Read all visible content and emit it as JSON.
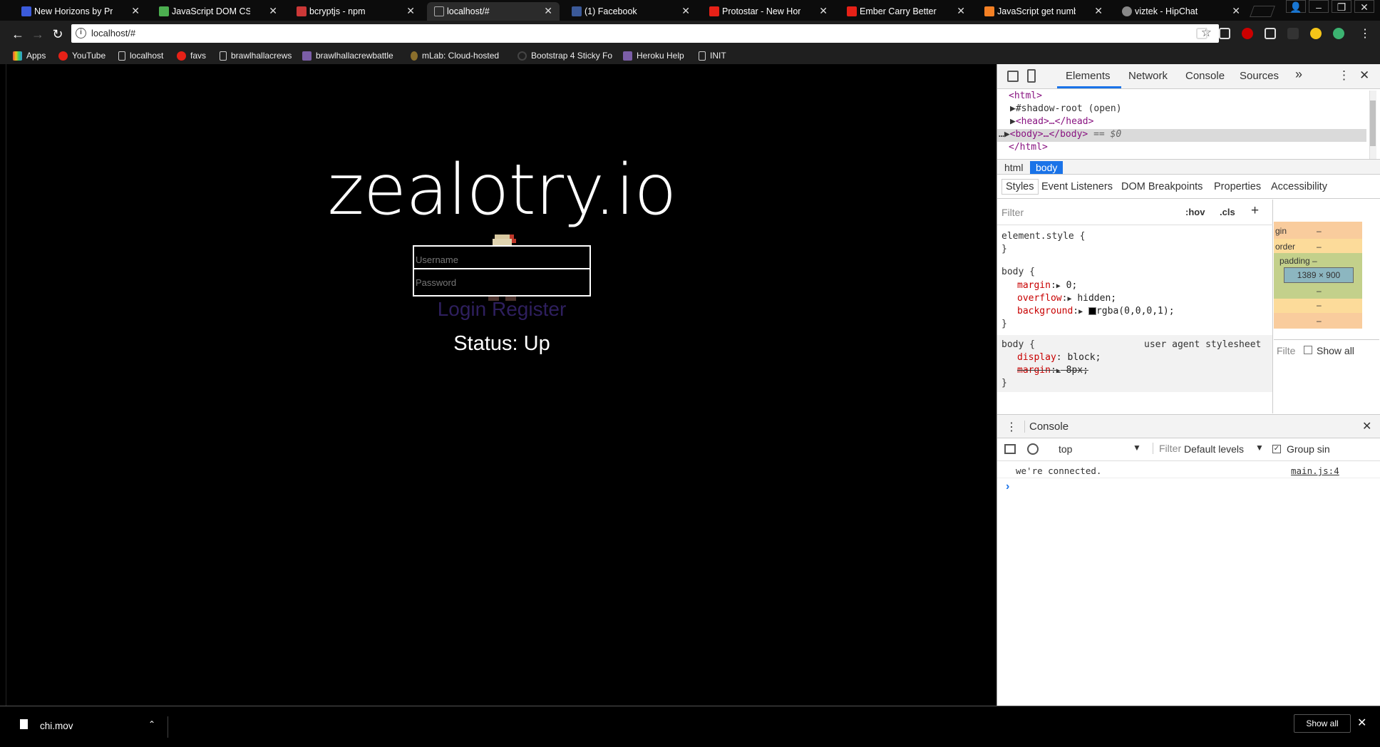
{
  "tabs": [
    {
      "title": "New Horizons by Protos",
      "color": "#3b5bdb"
    },
    {
      "title": "JavaScript DOM CSS",
      "color": "#4caf50"
    },
    {
      "title": "bcryptjs - npm",
      "color": "#cb3837"
    },
    {
      "title": "localhost/#",
      "color": "#888888"
    },
    {
      "title": "(1) Facebook",
      "color": "#3b5998"
    },
    {
      "title": "Protostar - New Horizon",
      "color": "#e62117"
    },
    {
      "title": "Ember Carry Better Than",
      "color": "#e62117"
    },
    {
      "title": "JavaScript get number fr",
      "color": "#f48024"
    },
    {
      "title": "viztek - HipChat",
      "color": "#888888"
    }
  ],
  "toolbar": {
    "url": "localhost/#"
  },
  "bookmarks": [
    {
      "label": "Apps",
      "color": "#e74c3c"
    },
    {
      "label": "YouTube",
      "color": "#e62117"
    },
    {
      "label": "localhost",
      "color": "#cccccc"
    },
    {
      "label": "favs",
      "color": "#e62117"
    },
    {
      "label": "brawlhallacrews",
      "color": "#cccccc"
    },
    {
      "label": "brawlhallacrewbattle",
      "color": "#7b5ea7"
    },
    {
      "label": "mLab: Cloud-hosted",
      "color": "#8b6f2c"
    },
    {
      "label": "Bootstrap 4 Sticky Fo",
      "color": "#444444"
    },
    {
      "label": "Heroku Help",
      "color": "#7b5ea7"
    },
    {
      "label": "INIT",
      "color": "#cccccc"
    }
  ],
  "page": {
    "logo": "zealotry.io",
    "username_placeholder": "Username",
    "password_placeholder": "Password",
    "login_label": "Login",
    "register_label": "Register",
    "status": "Status: Up"
  },
  "devtools": {
    "tabs": [
      "Elements",
      "Network",
      "Console",
      "Sources"
    ],
    "more": "»",
    "dom": {
      "html_open": "<html>",
      "shadow": "#shadow-root (open)",
      "head": "<head>…</head>",
      "body": "<body>…</body>",
      "body_suffix": "== $0",
      "html_close": "</html>"
    },
    "breadcrumbs": [
      "html",
      "body"
    ],
    "subtabs": [
      "Styles",
      "Event Listeners",
      "DOM Breakpoints",
      "Properties",
      "Accessibility"
    ],
    "styles_filter": "Filter",
    "hov": ":hov",
    "cls": ".cls",
    "plus": "+",
    "element_style": "element.style {",
    "close_brace": "}",
    "rule1_selector": "body {",
    "rule1_props": [
      {
        "name": "margin",
        "value": "0;"
      },
      {
        "name": "overflow",
        "value": "hidden;"
      },
      {
        "name": "background",
        "value": "rgba(0,0,0,1);"
      }
    ],
    "rule2_selector": "body {",
    "rule2_source": "user agent stylesheet",
    "rule2_props": [
      {
        "name": "display",
        "value": "block;"
      },
      {
        "name": "margin",
        "value": "8px;"
      }
    ],
    "boxmodel": {
      "margin": "gin",
      "border": "order",
      "padding": "padding –",
      "content": "1389 × 900",
      "dash": "–",
      "filter": "Filte",
      "show_all": "Show all"
    },
    "console": {
      "title": "Console",
      "context": "top",
      "filter": "Filter",
      "levels": "Default levels",
      "group": "Group sin",
      "message": "we're connected.",
      "source": "main.js:4",
      "prompt": "›"
    }
  },
  "download": {
    "file": "chi.mov",
    "show_all": "Show all"
  }
}
